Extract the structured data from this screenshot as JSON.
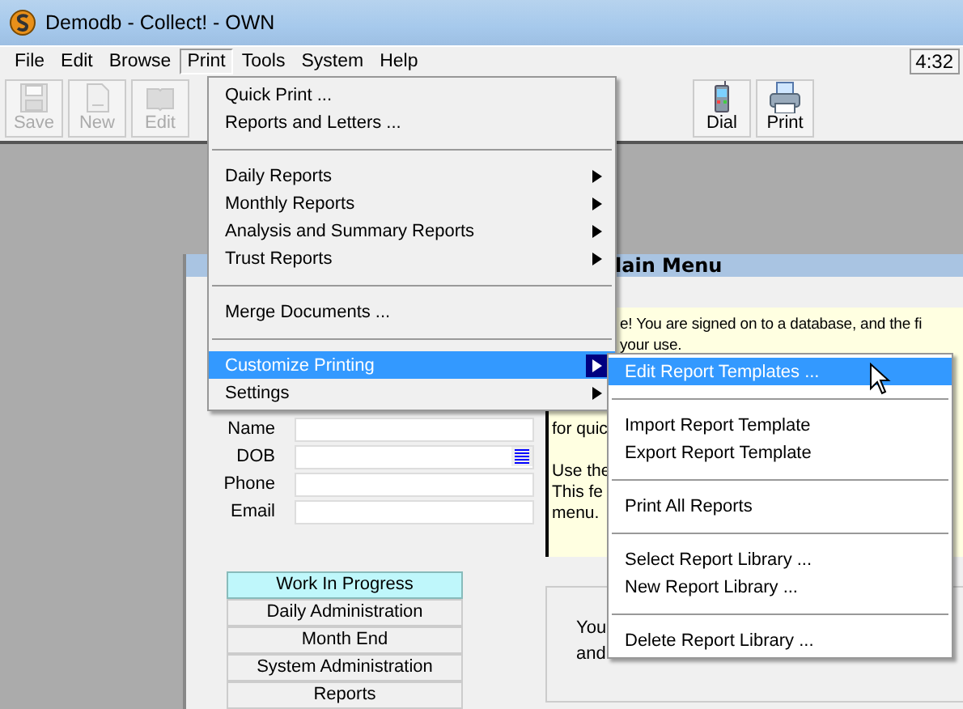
{
  "window": {
    "title": "Demodb - Collect! - OWN"
  },
  "menu_bar": {
    "items": [
      {
        "label": "File",
        "selected": false
      },
      {
        "label": "Edit",
        "selected": false
      },
      {
        "label": "Browse",
        "selected": false
      },
      {
        "label": "Print",
        "selected": true
      },
      {
        "label": "Tools",
        "selected": false
      },
      {
        "label": "System",
        "selected": false
      },
      {
        "label": "Help",
        "selected": false
      }
    ],
    "clock": "4:32"
  },
  "toolbar": {
    "left": [
      {
        "label": "Save",
        "kind": "save",
        "disabled": true
      },
      {
        "label": "New",
        "kind": "page",
        "disabled": true
      },
      {
        "label": "Edit",
        "kind": "book",
        "disabled": true
      }
    ],
    "right": [
      {
        "label": "Dial",
        "kind": "phone",
        "disabled": false
      },
      {
        "label": "Print",
        "kind": "printer",
        "disabled": false
      }
    ]
  },
  "main_menu_window": {
    "title": "lain Menu",
    "form": [
      {
        "label": "Name",
        "kind": "text"
      },
      {
        "label": "DOB",
        "kind": "date"
      },
      {
        "label": "Phone",
        "kind": "text"
      },
      {
        "label": "Email",
        "kind": "text"
      }
    ],
    "nav_buttons": [
      {
        "label": "Work In Progress",
        "selected": true
      },
      {
        "label": "Daily Administration",
        "selected": false
      },
      {
        "label": "Month End",
        "selected": false
      },
      {
        "label": "System Administration",
        "selected": false
      },
      {
        "label": "Reports",
        "selected": false
      }
    ],
    "notice_lines": [
      {
        "kind": "continued",
        "text": "e! You are signed on to a database, and the fi"
      },
      {
        "kind": "continued",
        "text": "your use."
      },
      {
        "kind": "blank"
      },
      {
        "kind": "blank"
      },
      {
        "kind": "blank"
      },
      {
        "kind": "text",
        "text": "for quic"
      },
      {
        "kind": "blank"
      },
      {
        "kind": "text",
        "text": "Use the"
      },
      {
        "kind": "text",
        "text": "This fe"
      },
      {
        "kind": "text",
        "text": "menu."
      }
    ],
    "lower_panel_lines": [
      "You",
      "and"
    ]
  },
  "print_menu": [
    {
      "kind": "item",
      "label": "Quick Print ..."
    },
    {
      "kind": "item",
      "label": "Reports and Letters ..."
    },
    {
      "kind": "separator"
    },
    {
      "kind": "submenu",
      "label": "Daily Reports",
      "selected": false
    },
    {
      "kind": "submenu",
      "label": "Monthly Reports",
      "selected": false
    },
    {
      "kind": "submenu",
      "label": "Analysis and Summary Reports",
      "selected": false
    },
    {
      "kind": "submenu",
      "label": "Trust Reports",
      "selected": false
    },
    {
      "kind": "separator"
    },
    {
      "kind": "item",
      "label": "Merge Documents ..."
    },
    {
      "kind": "separator"
    },
    {
      "kind": "submenu",
      "label": "Customize Printing",
      "selected": true
    },
    {
      "kind": "submenu",
      "label": "Settings",
      "selected": false
    }
  ],
  "customize_submenu": [
    {
      "kind": "item",
      "label": "Edit Report Templates ...",
      "selected": true
    },
    {
      "kind": "separator"
    },
    {
      "kind": "item",
      "label": "Import Report Template",
      "selected": false
    },
    {
      "kind": "item",
      "label": "Export Report Template",
      "selected": false
    },
    {
      "kind": "separator"
    },
    {
      "kind": "item",
      "label": "Print All Reports",
      "selected": false
    },
    {
      "kind": "separator"
    },
    {
      "kind": "item",
      "label": "Select Report Library ...",
      "selected": false
    },
    {
      "kind": "item",
      "label": "New Report Library ...",
      "selected": false
    },
    {
      "kind": "separator"
    },
    {
      "kind": "item",
      "label": "Delete Report Library ...",
      "selected": false
    }
  ]
}
